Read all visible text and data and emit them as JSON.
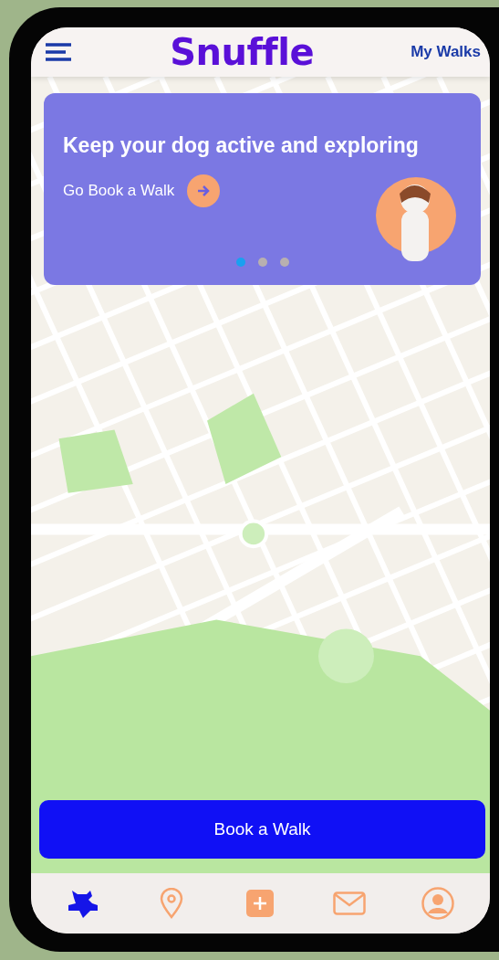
{
  "header": {
    "logo": "Snuffle",
    "link": "My Walks"
  },
  "banner": {
    "title": "Keep your dog active and exploring",
    "cta": "Go Book a Walk",
    "dots": [
      {
        "selected": true
      },
      {
        "selected": false
      },
      {
        "selected": false
      }
    ]
  },
  "primary_button": "Book a Walk",
  "nav": [
    {
      "kind": "dog",
      "selected": true
    },
    {
      "kind": "pin",
      "selected": false
    },
    {
      "kind": "add",
      "selected": false
    },
    {
      "kind": "mail",
      "selected": false
    },
    {
      "kind": "profile",
      "selected": false
    }
  ]
}
